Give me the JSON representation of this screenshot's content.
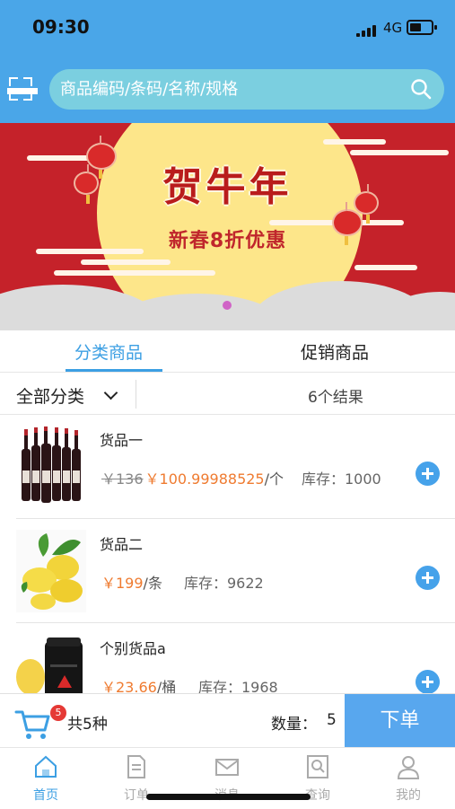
{
  "status": {
    "time": "09:30",
    "network": "4G"
  },
  "search": {
    "placeholder": "商品编码/条码/名称/规格"
  },
  "banner": {
    "title": "贺牛年",
    "subtitle": "新春8折优惠"
  },
  "tabs": [
    {
      "label": "分类商品",
      "active": true
    },
    {
      "label": "促销商品",
      "active": false
    }
  ],
  "filter": {
    "category": "全部分类",
    "result_count": "6个结果"
  },
  "products": [
    {
      "name": "货品一",
      "old_price": "￥136",
      "price": "￥100.99988525",
      "unit": "/个",
      "stock": "库存：1000",
      "image": "wine-bottles"
    },
    {
      "name": "货品二",
      "old_price": "",
      "price": "￥199",
      "unit": "/条",
      "stock": "库存：9622",
      "image": "lemons"
    },
    {
      "name": "个别货品a",
      "old_price": "",
      "price": "￥23.66",
      "unit": "/桶",
      "stock": "库存：1968",
      "image": "jar-and-lemon"
    }
  ],
  "cart": {
    "badge": "5",
    "kinds_text": "共5种",
    "qty_label": "数量：",
    "qty_value": "5",
    "order_label": "下单"
  },
  "bottom_nav": [
    {
      "label": "首页",
      "icon": "home-icon",
      "active": true
    },
    {
      "label": "订单",
      "icon": "document-icon",
      "active": false
    },
    {
      "label": "消息",
      "icon": "envelope-icon",
      "active": false
    },
    {
      "label": "查询",
      "icon": "query-icon",
      "active": false
    },
    {
      "label": "我的",
      "icon": "person-icon",
      "active": false
    }
  ],
  "colors": {
    "accent": "#3c9fe3",
    "header": "#4aa6e8",
    "price": "#ef7b30",
    "banner": "#c5222a"
  }
}
